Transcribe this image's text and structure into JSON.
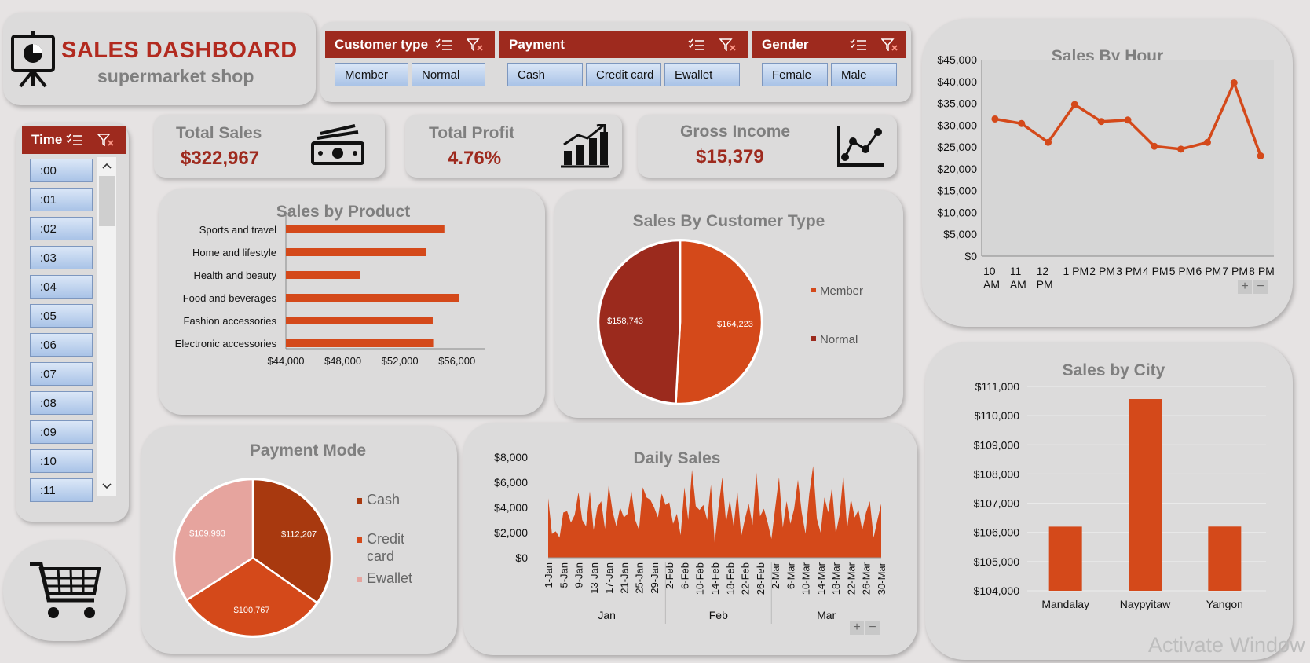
{
  "header": {
    "title": "SALES DASHBOARD",
    "subtitle": "supermarket shop"
  },
  "slicers": {
    "customer_type": {
      "label": "Customer type",
      "items": [
        "Member",
        "Normal"
      ]
    },
    "payment": {
      "label": "Payment",
      "items": [
        "Cash",
        "Credit card",
        "Ewallet"
      ]
    },
    "gender": {
      "label": "Gender",
      "items": [
        "Female",
        "Male"
      ]
    },
    "time": {
      "label": "Time",
      "items": [
        ":00",
        ":01",
        ":02",
        ":03",
        ":04",
        ":05",
        ":06",
        ":07",
        ":08",
        ":09",
        ":10",
        ":11"
      ]
    }
  },
  "kpis": [
    {
      "label": "Total Sales",
      "value": "$322,967"
    },
    {
      "label": "Total Profit",
      "value": "4.76%"
    },
    {
      "label": "Gross Income",
      "value": "$15,379"
    }
  ],
  "watermark": "Activate Window",
  "colors": {
    "accent": "#9e2a1e",
    "orange": "#d4491a",
    "pink": "#e6a49e",
    "dark_red": "#9b2a1d",
    "brown": "#a8390f"
  },
  "chart_data": [
    {
      "id": "sales_by_product",
      "type": "bar",
      "orientation": "horizontal",
      "title": "Sales by Product",
      "categories": [
        "Sports and travel",
        "Home and lifestyle",
        "Health and beauty",
        "Food and beverages",
        "Fashion accessories",
        "Electronic accessories"
      ],
      "values": [
        55123,
        53862,
        49193,
        56145,
        54306,
        54338
      ],
      "xlim": [
        44000,
        58000
      ],
      "ticks": [
        "$44,000",
        "$48,000",
        "$52,000",
        "$56,000"
      ],
      "tick_values": [
        44000,
        48000,
        52000,
        56000
      ]
    },
    {
      "id": "sales_by_customer_type",
      "type": "pie",
      "title": "Sales By Customer Type",
      "labels": [
        "Member",
        "Normal"
      ],
      "values": [
        164223,
        158743
      ],
      "data_labels": [
        "$164,223",
        "$158,743"
      ],
      "colors": [
        "#d4491a",
        "#9b2a1d"
      ],
      "legend": "right"
    },
    {
      "id": "sales_by_hour",
      "type": "line",
      "title": "Sales By Hour",
      "categories": [
        "10 AM",
        "11 AM",
        "12 PM",
        "1 PM",
        "2 PM",
        "3 PM",
        "4 PM",
        "5 PM",
        "6 PM",
        "7 PM",
        "8 PM"
      ],
      "category_labels": [
        [
          "10",
          "AM"
        ],
        [
          "11",
          "AM"
        ],
        [
          "12",
          "PM"
        ],
        [
          "1 PM"
        ],
        [
          "2 PM"
        ],
        [
          "3 PM"
        ],
        [
          "4 PM"
        ],
        [
          "5 PM"
        ],
        [
          "6 PM"
        ],
        [
          "7 PM"
        ],
        [
          "8 PM"
        ]
      ],
      "values": [
        31421,
        30378,
        26066,
        34724,
        30829,
        31180,
        25159,
        24505,
        26060,
        39700,
        22970
      ],
      "ylim": [
        0,
        45000
      ],
      "ticks": [
        "$0",
        "$5,000",
        "$10,000",
        "$15,000",
        "$20,000",
        "$25,000",
        "$30,000",
        "$35,000",
        "$40,000",
        "$45,000"
      ]
    },
    {
      "id": "payment_mode",
      "type": "pie",
      "title": "Payment Mode",
      "labels": [
        "Cash",
        "Credit card",
        "Ewallet"
      ],
      "values": [
        112207,
        100767,
        109993
      ],
      "data_labels": [
        "$112,207",
        "$100,767",
        "$109,993"
      ],
      "colors": [
        "#a8390f",
        "#d4491a",
        "#e6a49e"
      ],
      "legend": "right"
    },
    {
      "id": "daily_sales",
      "type": "area",
      "title": "Daily Sales",
      "x_labels": [
        "1-Jan",
        "5-Jan",
        "9-Jan",
        "13-Jan",
        "17-Jan",
        "21-Jan",
        "25-Jan",
        "29-Jan",
        "2-Feb",
        "6-Feb",
        "10-Feb",
        "14-Feb",
        "18-Feb",
        "22-Feb",
        "26-Feb",
        "2-Mar",
        "6-Mar",
        "10-Mar",
        "14-Mar",
        "18-Mar",
        "22-Mar",
        "26-Mar",
        "30-Mar"
      ],
      "months": [
        "Jan",
        "Feb",
        "Mar"
      ],
      "values": [
        4745,
        1900,
        2100,
        1600,
        3600,
        3700,
        2800,
        3400,
        5200,
        3000,
        2500,
        5300,
        2200,
        4000,
        4500,
        2300,
        5800,
        3700,
        2500,
        4000,
        3200,
        3500,
        5300,
        3000,
        2200,
        5600,
        4800,
        4600,
        4000,
        3200,
        5100,
        4200,
        4400,
        2700,
        3500,
        1800,
        5600,
        3000,
        7000,
        4100,
        3800,
        4200,
        3000,
        5800,
        1200,
        4000,
        6400,
        2800,
        4600,
        2500,
        5300,
        1700,
        3100,
        4300,
        2600,
        6800,
        3300,
        3900,
        2800,
        1500,
        4000,
        6400,
        2400,
        4500,
        2700,
        3900,
        6200,
        3600,
        1900,
        5100,
        7300,
        3100,
        2000,
        4800,
        3600,
        5600,
        1900,
        3400,
        6600,
        2300,
        4700,
        3200,
        3800,
        2200,
        3600,
        4500,
        1600,
        3000,
        4300
      ],
      "ylim": [
        0,
        8000
      ],
      "ticks": [
        "$0",
        "$2,000",
        "$4,000",
        "$6,000",
        "$8,000"
      ]
    },
    {
      "id": "sales_by_city",
      "type": "bar",
      "title": "Sales by City",
      "categories": [
        "Mandalay",
        "Naypyitaw",
        "Yangon"
      ],
      "values": [
        106197,
        110569,
        106200
      ],
      "ylim": [
        104000,
        111000
      ],
      "ticks": [
        "$104,000",
        "$105,000",
        "$106,000",
        "$107,000",
        "$108,000",
        "$109,000",
        "$110,000",
        "$111,000"
      ]
    }
  ]
}
